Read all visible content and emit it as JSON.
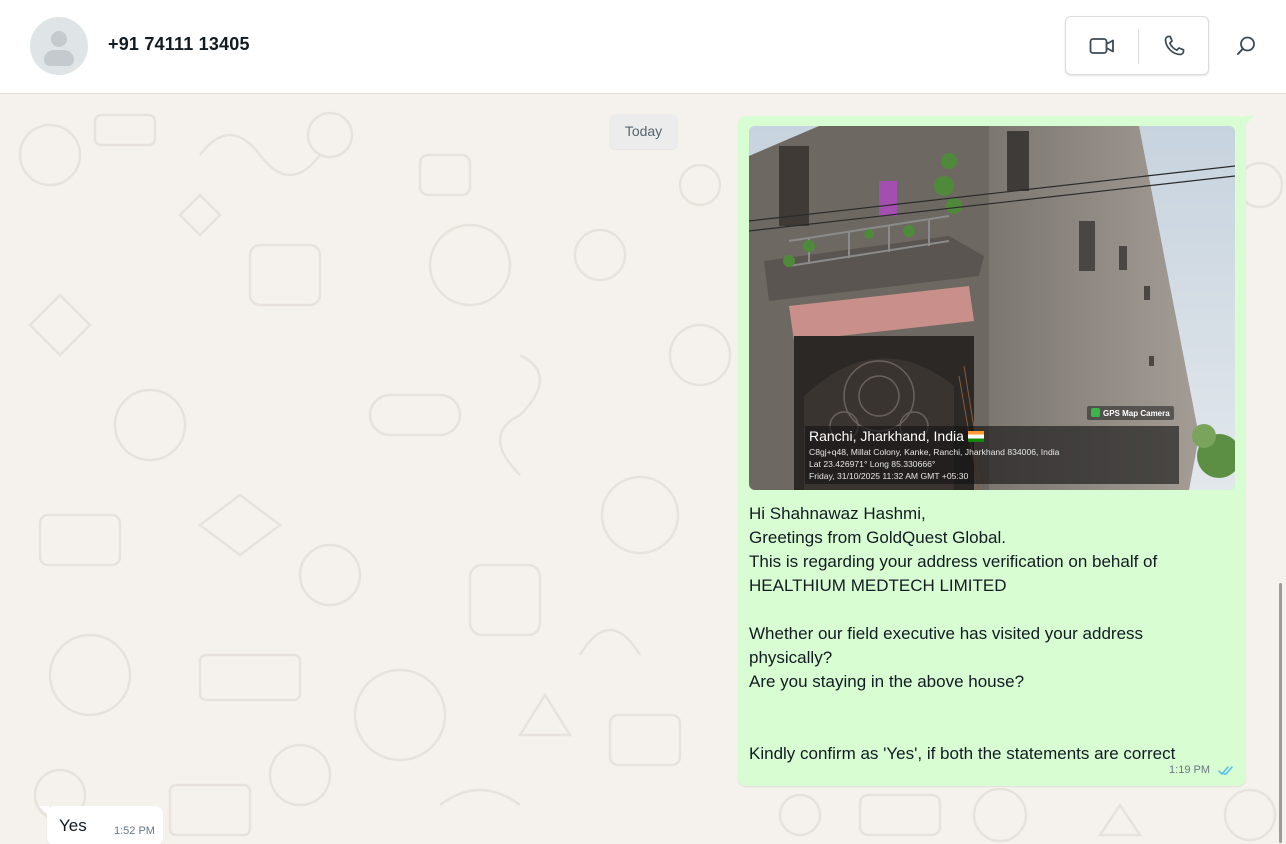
{
  "header": {
    "contact_name": "+91 74111 13405",
    "icons": {
      "avatar": "default-avatar",
      "video": "video-camera-icon",
      "voice": "phone-icon",
      "search": "search-icon"
    }
  },
  "chat": {
    "date_label": "Today",
    "outgoing": {
      "photo_overlay": {
        "brand": "GPS Map Camera",
        "city": "Ranchi, Jharkhand, India",
        "address": "C8gj+q48, Millat Colony, Kanke, Ranchi, Jharkhand 834006, India",
        "coords": "Lat 23.426971° Long 85.330666°",
        "datetime": "Friday, 31/10/2025 11:32 AM GMT +05:30"
      },
      "lines": [
        "Hi Shahnawaz Hashmi,",
        "Greetings from GoldQuest Global.",
        "This is regarding your address verification on behalf of",
        "HEALTHIUM MEDTECH LIMITED",
        "",
        "Whether our field executive has visited your address",
        "physically?",
        "Are you staying in the above house?",
        "",
        "",
        "Kindly confirm as 'Yes', if both the statements are correct"
      ],
      "time": "1:19 PM",
      "status": "read"
    },
    "incoming": {
      "text": "Yes",
      "time": "1:52 PM"
    }
  },
  "colors": {
    "outgoing_bubble": "#d9fdd3",
    "incoming_bubble": "#ffffff",
    "chat_background": "#f5f1ec",
    "read_ticks": "#53bdeb"
  }
}
